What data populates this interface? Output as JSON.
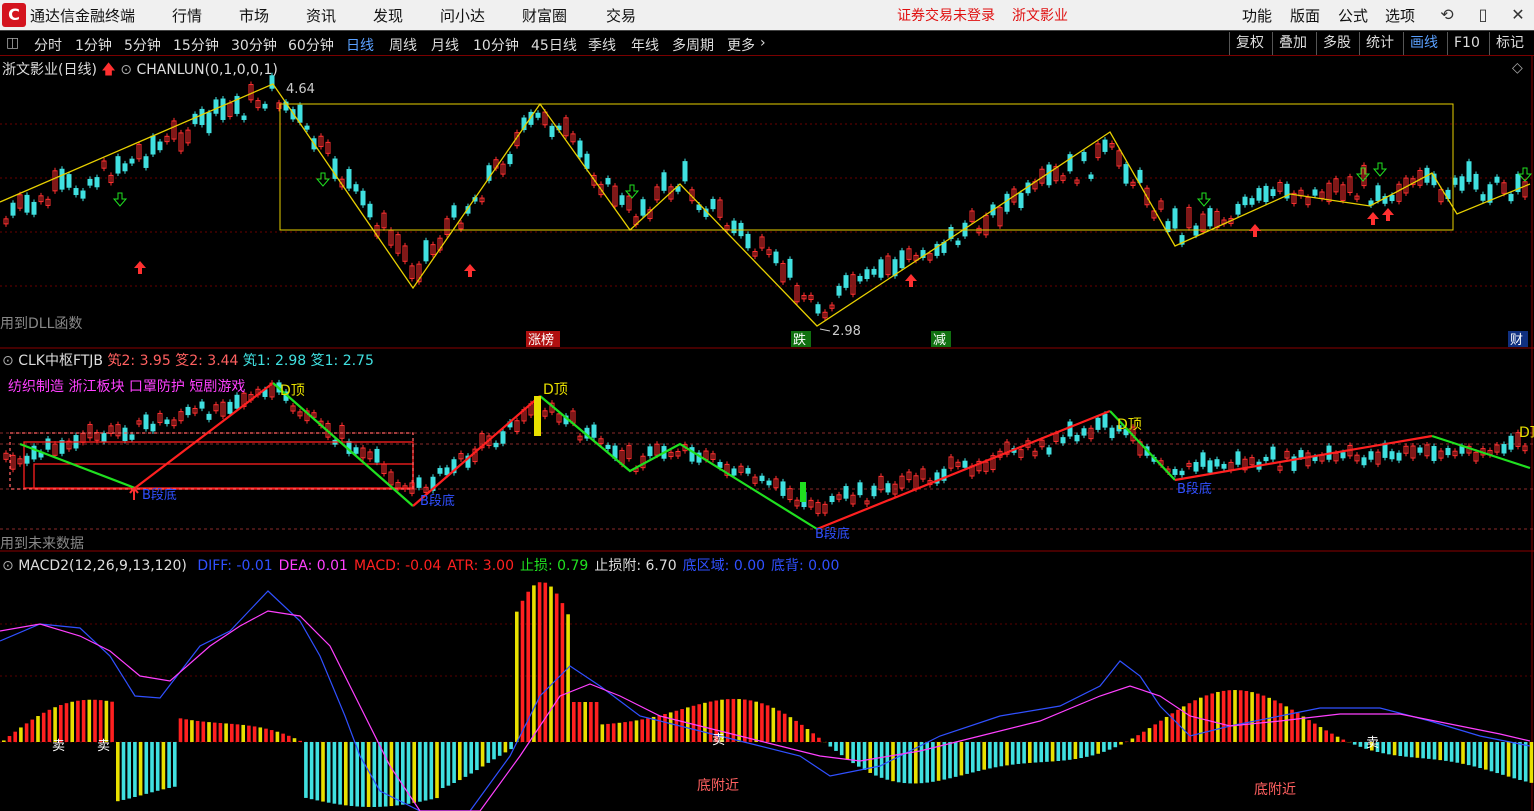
{
  "app": {
    "title": "通达信金融终端",
    "login_notice": "证券交易未登录",
    "stock_name": "浙文影业"
  },
  "menu": [
    "行情",
    "市场",
    "资讯",
    "发现",
    "问小达",
    "财富圈",
    "交易"
  ],
  "right_menu": [
    "功能",
    "版面",
    "公式",
    "选项"
  ],
  "periods": [
    "分时",
    "1分钟",
    "5分钟",
    "15分钟",
    "30分钟",
    "60分钟",
    "日线",
    "周线",
    "月线",
    "10分钟",
    "45日线",
    "季线",
    "年线",
    "多周期",
    "更多"
  ],
  "active_period": "日线",
  "right_tools": [
    "复权",
    "叠加",
    "多股",
    "统计",
    "画线",
    "F10",
    "标记"
  ],
  "active_tool": "画线",
  "main_panel": {
    "title": "浙文影业(日线)",
    "indicator": "CHANLUN(0,1,0,0,1)",
    "high_label": "4.64",
    "low_label": "2.98",
    "note": "用到DLL函数",
    "tags": [
      "涨榜",
      "跌",
      "减",
      "财"
    ]
  },
  "clk_panel": {
    "name": "CLK中枢FTJB",
    "values": [
      {
        "label": "笂2:",
        "value": "3.95"
      },
      {
        "label": "笅2:",
        "value": "3.44"
      },
      {
        "label": "笂1:",
        "value": "2.98"
      },
      {
        "label": "笅1:",
        "value": "2.75"
      }
    ],
    "sector_text": "纺织制造 浙江板块 口罩防护 短剧游戏",
    "note": "用到未来数据",
    "top_labels": [
      "D顶",
      "D顶",
      "D顶",
      "D顶"
    ],
    "bottom_labels": [
      "B段底",
      "B段底",
      "B段底",
      "B段底"
    ]
  },
  "macd_panel": {
    "name": "MACD2(12,26,9,13,120)",
    "items": [
      {
        "label": "DIFF:",
        "value": "-0.01",
        "color": "#3050ff"
      },
      {
        "label": "DEA:",
        "value": "0.01",
        "color": "#ff40ff"
      },
      {
        "label": "MACD:",
        "value": "-0.04",
        "color": "#ff2020"
      },
      {
        "label": "ATR:",
        "value": "3.00",
        "color": "#ff2020"
      },
      {
        "label": "止损:",
        "value": "0.79",
        "color": "#20e020"
      },
      {
        "label": "止损附:",
        "value": "6.70",
        "color": "#dddddd"
      },
      {
        "label": "底区域:",
        "value": "0.00",
        "color": "#3050ff"
      },
      {
        "label": "底背:",
        "value": "0.00",
        "color": "#3050ff"
      }
    ],
    "sell_labels": [
      "卖",
      "卖",
      "卖",
      "卖"
    ],
    "bottom_notes": [
      "底附近",
      "底附近"
    ]
  },
  "colors": {
    "up": "#ff3030",
    "down": "#40e0e0",
    "zigzag": "#e8d000",
    "stroke_up": "#ff2020",
    "stroke_down": "#20e020"
  }
}
